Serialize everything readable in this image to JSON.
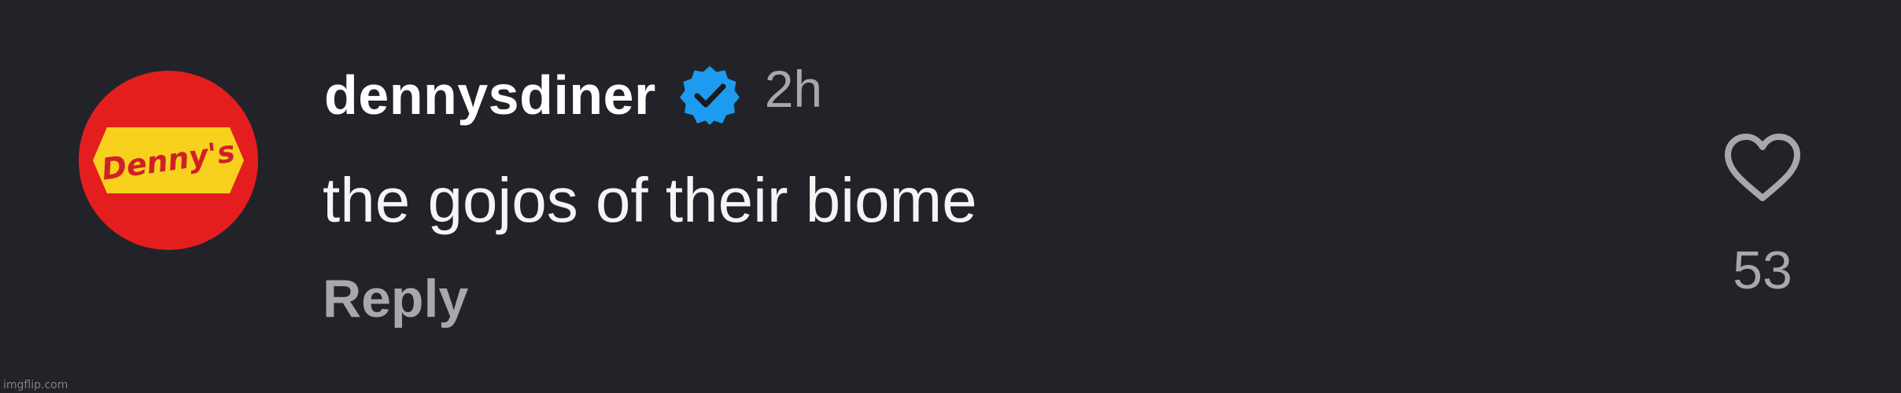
{
  "comment": {
    "avatar": {
      "icon": "dennys-logo",
      "logo_text": "Denny's",
      "background_color": "#e41e1f",
      "badge_color": "#f7d11e"
    },
    "username": "dennysdiner",
    "verified_icon": "verified-badge-icon",
    "verified_color": "#1d9bf0",
    "timestamp": "2h",
    "text": "the gojos of their biome",
    "reply_label": "Reply",
    "like": {
      "icon": "heart-outline-icon",
      "count": "53"
    }
  },
  "watermark": "imgflip.com"
}
